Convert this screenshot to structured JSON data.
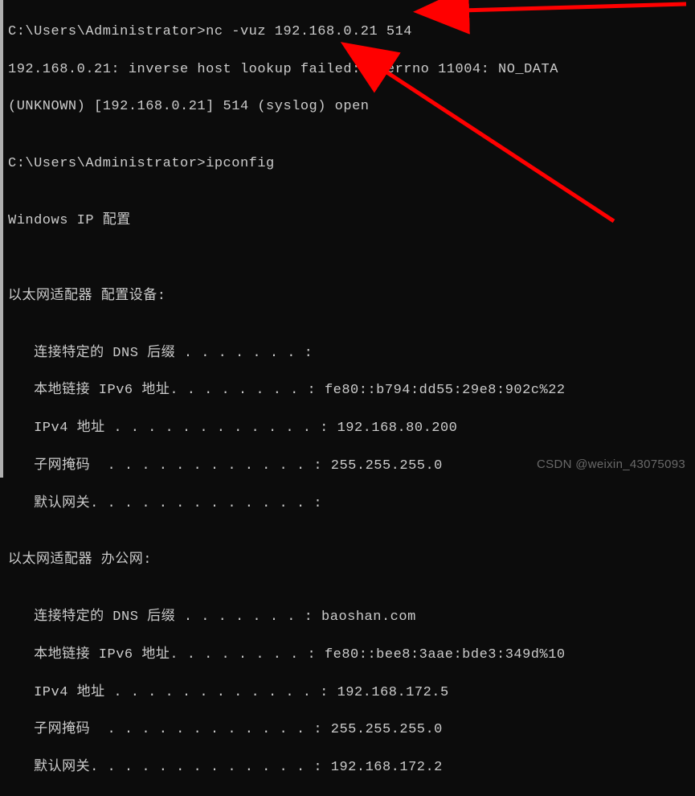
{
  "colors": {
    "bg": "#0c0c0c",
    "fg": "#cccccc",
    "arrow": "#ff0000"
  },
  "prompt1": {
    "path": "C:\\Users\\Administrator>",
    "cmd": "nc -vuz 192.168.0.21 514"
  },
  "nc_out1": "192.168.0.21: inverse host lookup failed: h_errno 11004: NO_DATA",
  "nc_out2": "(UNKNOWN) [192.168.0.21] 514 (syslog) open",
  "prompt2": {
    "path": "C:\\Users\\Administrator>",
    "cmd": "ipconfig"
  },
  "ip_heading": "Windows IP 配置",
  "adapters": [
    {
      "title": "以太网适配器 配置设备:",
      "rows": [
        {
          "label": "   连接特定的 DNS 后缀 . . . . . . . :",
          "value": ""
        },
        {
          "label": "   本地链接 IPv6 地址. . . . . . . . : ",
          "value": "fe80::b794:dd55:29e8:902c%22"
        },
        {
          "label": "   IPv4 地址 . . . . . . . . . . . . : ",
          "value": "192.168.80.200"
        },
        {
          "label": "   子网掩码  . . . . . . . . . . . . : ",
          "value": "255.255.255.0"
        },
        {
          "label": "   默认网关. . . . . . . . . . . . . :",
          "value": ""
        }
      ]
    },
    {
      "title": "以太网适配器 办公网:",
      "rows": [
        {
          "label": "   连接特定的 DNS 后缀 . . . . . . . : ",
          "value": "baoshan.com"
        },
        {
          "label": "   本地链接 IPv6 地址. . . . . . . . : ",
          "value": "fe80::bee8:3aae:bde3:349d%10"
        },
        {
          "label": "   IPv4 地址 . . . . . . . . . . . . : ",
          "value": "192.168.172.5"
        },
        {
          "label": "   子网掩码  . . . . . . . . . . . . : ",
          "value": "255.255.255.0"
        },
        {
          "label": "   默认网关. . . . . . . . . . . . . : ",
          "value": "192.168.172.2"
        }
      ]
    }
  ],
  "watermark": "CSDN @weixin_43075093"
}
